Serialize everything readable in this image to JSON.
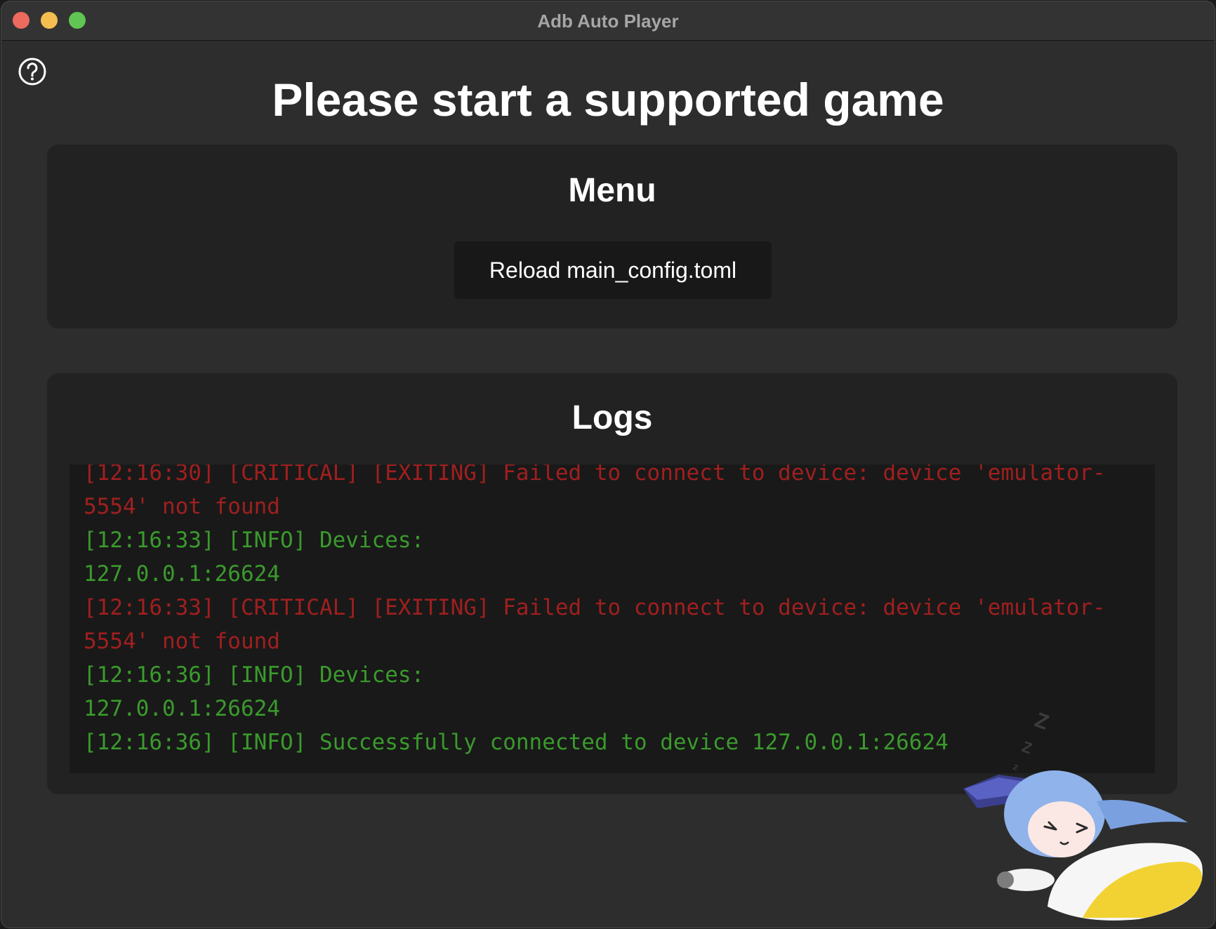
{
  "window": {
    "title": "Adb Auto Player"
  },
  "help": {
    "icon": "question-circle-icon"
  },
  "page": {
    "title": "Please start a supported game"
  },
  "menu": {
    "title": "Menu",
    "reload_label": "Reload main_config.toml"
  },
  "logs": {
    "title": "Logs",
    "lines": [
      {
        "level": "critical",
        "text": "[12:16:30] [CRITICAL] [EXITING] Failed to connect to device: device 'emulator-"
      },
      {
        "level": "critical",
        "text": "5554' not found"
      },
      {
        "level": "info",
        "text": "[12:16:33] [INFO] Devices:"
      },
      {
        "level": "info",
        "text": "127.0.0.1:26624"
      },
      {
        "level": "critical",
        "text": "[12:16:33] [CRITICAL] [EXITING] Failed to connect to device: device 'emulator-"
      },
      {
        "level": "critical",
        "text": "5554' not found"
      },
      {
        "level": "info",
        "text": "[12:16:36] [INFO] Devices:"
      },
      {
        "level": "info",
        "text": "127.0.0.1:26624"
      },
      {
        "level": "info",
        "text": "[12:16:36] [INFO] Successfully connected to device 127.0.0.1:26624"
      }
    ]
  },
  "colors": {
    "critical": "#a01f1f",
    "info": "#3a9a2c",
    "background": "#2d2d2d",
    "card": "#222222"
  }
}
